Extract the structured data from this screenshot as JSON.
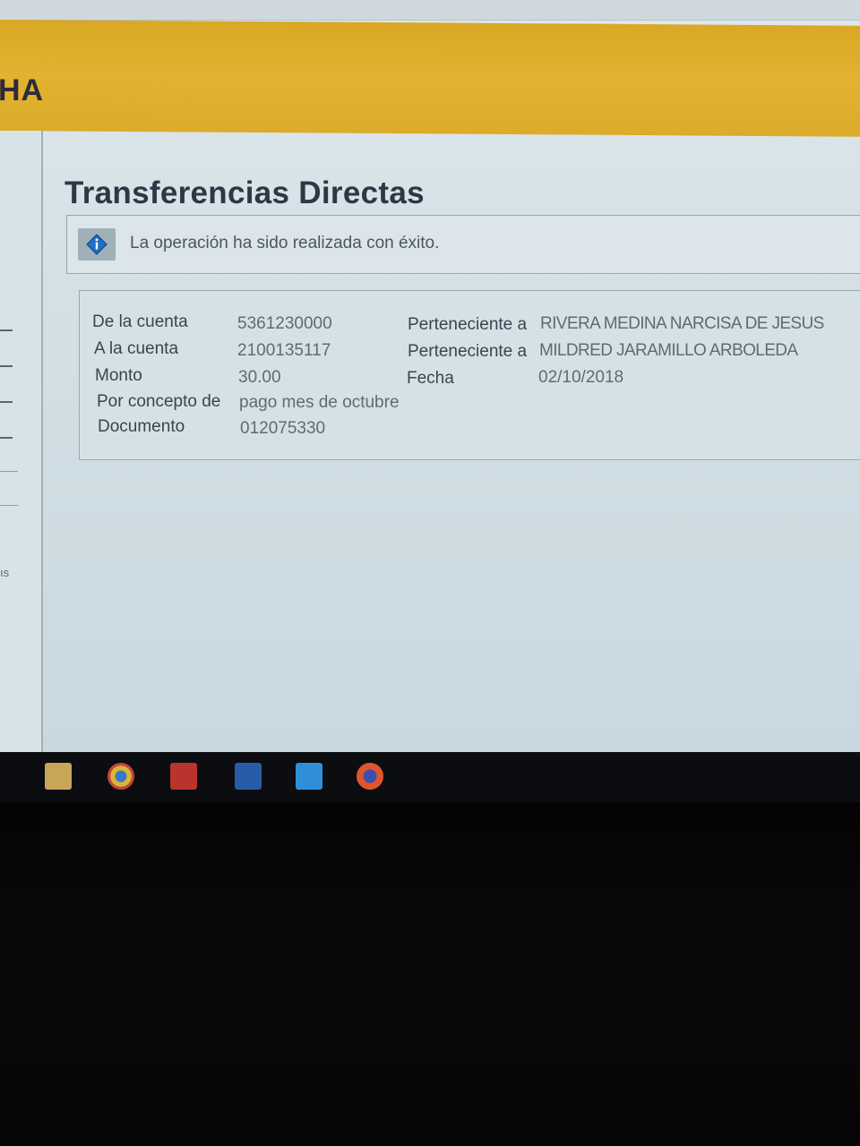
{
  "header": {
    "brand_fragment": "HA"
  },
  "sidebar": {
    "text_fragment": "ıs"
  },
  "page": {
    "title": "Transferencias Directas"
  },
  "message": {
    "icon": "info-icon",
    "text": "La operación ha sido realizada con éxito."
  },
  "details": {
    "from_label": "De la cuenta",
    "from_value": "5361230000",
    "from_owner_label": "Perteneciente a",
    "from_owner_value": "RIVERA MEDINA NARCISA DE JESUS",
    "to_label": "A la cuenta",
    "to_value": "2100135117",
    "to_owner_label": "Perteneciente a",
    "to_owner_value": "MILDRED JARAMILLO ARBOLEDA",
    "amount_label": "Monto",
    "amount_value": "30.00",
    "date_label": "Fecha",
    "date_value": "02/10/2018",
    "concept_label": "Por concepto de",
    "concept_value": "pago mes de octubre",
    "document_label": "Documento",
    "document_value": "012075330"
  },
  "taskbar": {
    "icons": [
      "file-explorer-icon",
      "chrome-icon",
      "acrobat-icon",
      "word-icon",
      "dropbox-icon",
      "firefox-icon"
    ]
  },
  "colors": {
    "header_yellow": "#dcab2a",
    "title_text": "#2d3846",
    "info_blue": "#1f6fc9"
  }
}
